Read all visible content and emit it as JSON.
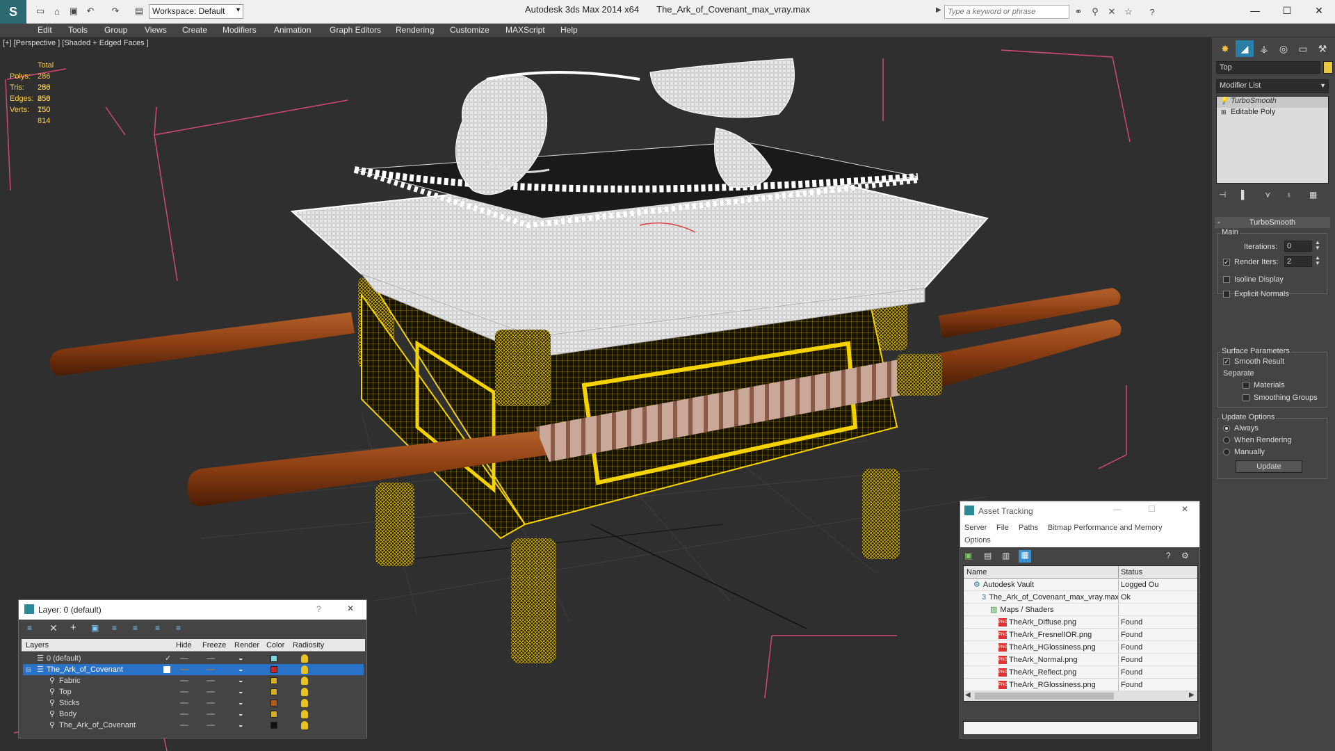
{
  "titlebar": {
    "app_title": "Autodesk 3ds Max 2014 x64",
    "file_name": "The_Ark_of_Covenant_max_vray.max",
    "workspace_label": "Workspace: Default",
    "search_placeholder": "Type a keyword or phrase",
    "logo_icon": "3dsmax-logo-icon"
  },
  "menu": {
    "items": [
      "Edit",
      "Tools",
      "Group",
      "Views",
      "Create",
      "Modifiers",
      "Animation",
      "Graph Editors",
      "Rendering",
      "Customize",
      "MAXScript",
      "Help"
    ]
  },
  "viewport": {
    "label": "[+] [Perspective ] [Shaded + Edged Faces ]",
    "stats": {
      "total_label": "Total",
      "polys_label": "Polys:",
      "polys": "286 250",
      "tris_label": "Tris:",
      "tris": "286 250",
      "edges_label": "Edges:",
      "edges": "858 750",
      "verts_label": "Verts:",
      "verts": "150 814"
    },
    "colors": {
      "background": "#2f2f2f",
      "wire_white": "#f2f2f2",
      "wire_yellow": "#f5d300",
      "rod": "#8a3d12",
      "bbox": "#d04a7a"
    }
  },
  "command_panel": {
    "object_name": "Top",
    "modifier_list_label": "Modifier List",
    "stack": [
      "TurboSmooth",
      "Editable Poly"
    ],
    "turbosmooth": {
      "title": "TurboSmooth",
      "main_label": "Main",
      "iterations_label": "Iterations:",
      "iterations": "0",
      "render_iters_label": "Render Iters:",
      "render_iters": "2",
      "isoline_label": "Isoline Display",
      "explicit_normals_label": "Explicit Normals",
      "surface_params_label": "Surface Parameters",
      "smooth_result_label": "Smooth Result",
      "separate_label": "Separate",
      "materials_label": "Materials",
      "smoothing_groups_label": "Smoothing Groups",
      "update_options_label": "Update Options",
      "always_label": "Always",
      "when_rendering_label": "When Rendering",
      "manually_label": "Manually",
      "update_button": "Update"
    }
  },
  "layer_window": {
    "title": "Layer: 0 (default)",
    "columns": [
      "Layers",
      "Hide",
      "Freeze",
      "Render",
      "Color",
      "Radiosity"
    ],
    "rows": [
      {
        "name": "0 (default)",
        "color": "#7fd8e0",
        "selected": false,
        "indent": 0
      },
      {
        "name": "The_Ark_of_Covenant",
        "color": "#cc2222",
        "selected": true,
        "indent": 0
      },
      {
        "name": "Fabric",
        "color": "#d8b020",
        "selected": false,
        "indent": 1
      },
      {
        "name": "Top",
        "color": "#d8b020",
        "selected": false,
        "indent": 1
      },
      {
        "name": "Sticks",
        "color": "#b85a10",
        "selected": false,
        "indent": 1
      },
      {
        "name": "Body",
        "color": "#d8b020",
        "selected": false,
        "indent": 1
      },
      {
        "name": "The_Ark_of_Covenant",
        "color": "#111111",
        "selected": false,
        "indent": 1
      }
    ]
  },
  "asset_window": {
    "title": "Asset Tracking",
    "menu": [
      "Server",
      "File",
      "Paths",
      "Bitmap Performance and Memory",
      "Options"
    ],
    "columns": [
      "Name",
      "Status"
    ],
    "rows": [
      {
        "name": "Autodesk Vault",
        "status": "Logged Ou",
        "indent": 0,
        "icon": "vault-icon"
      },
      {
        "name": "The_Ark_of_Covenant_max_vray.max",
        "status": "Ok",
        "indent": 1,
        "icon": "max-file-icon"
      },
      {
        "name": "Maps / Shaders",
        "status": "",
        "indent": 2,
        "icon": "maps-icon"
      },
      {
        "name": "TheArk_Diffuse.png",
        "status": "Found",
        "indent": 3,
        "icon": "png-icon"
      },
      {
        "name": "TheArk_FresnelIOR.png",
        "status": "Found",
        "indent": 3,
        "icon": "png-icon"
      },
      {
        "name": "TheArk_HGlossiness.png",
        "status": "Found",
        "indent": 3,
        "icon": "png-icon"
      },
      {
        "name": "TheArk_Normal.png",
        "status": "Found",
        "indent": 3,
        "icon": "png-icon"
      },
      {
        "name": "TheArk_Reflect.png",
        "status": "Found",
        "indent": 3,
        "icon": "png-icon"
      },
      {
        "name": "TheArk_RGlossiness.png",
        "status": "Found",
        "indent": 3,
        "icon": "png-icon"
      }
    ]
  }
}
